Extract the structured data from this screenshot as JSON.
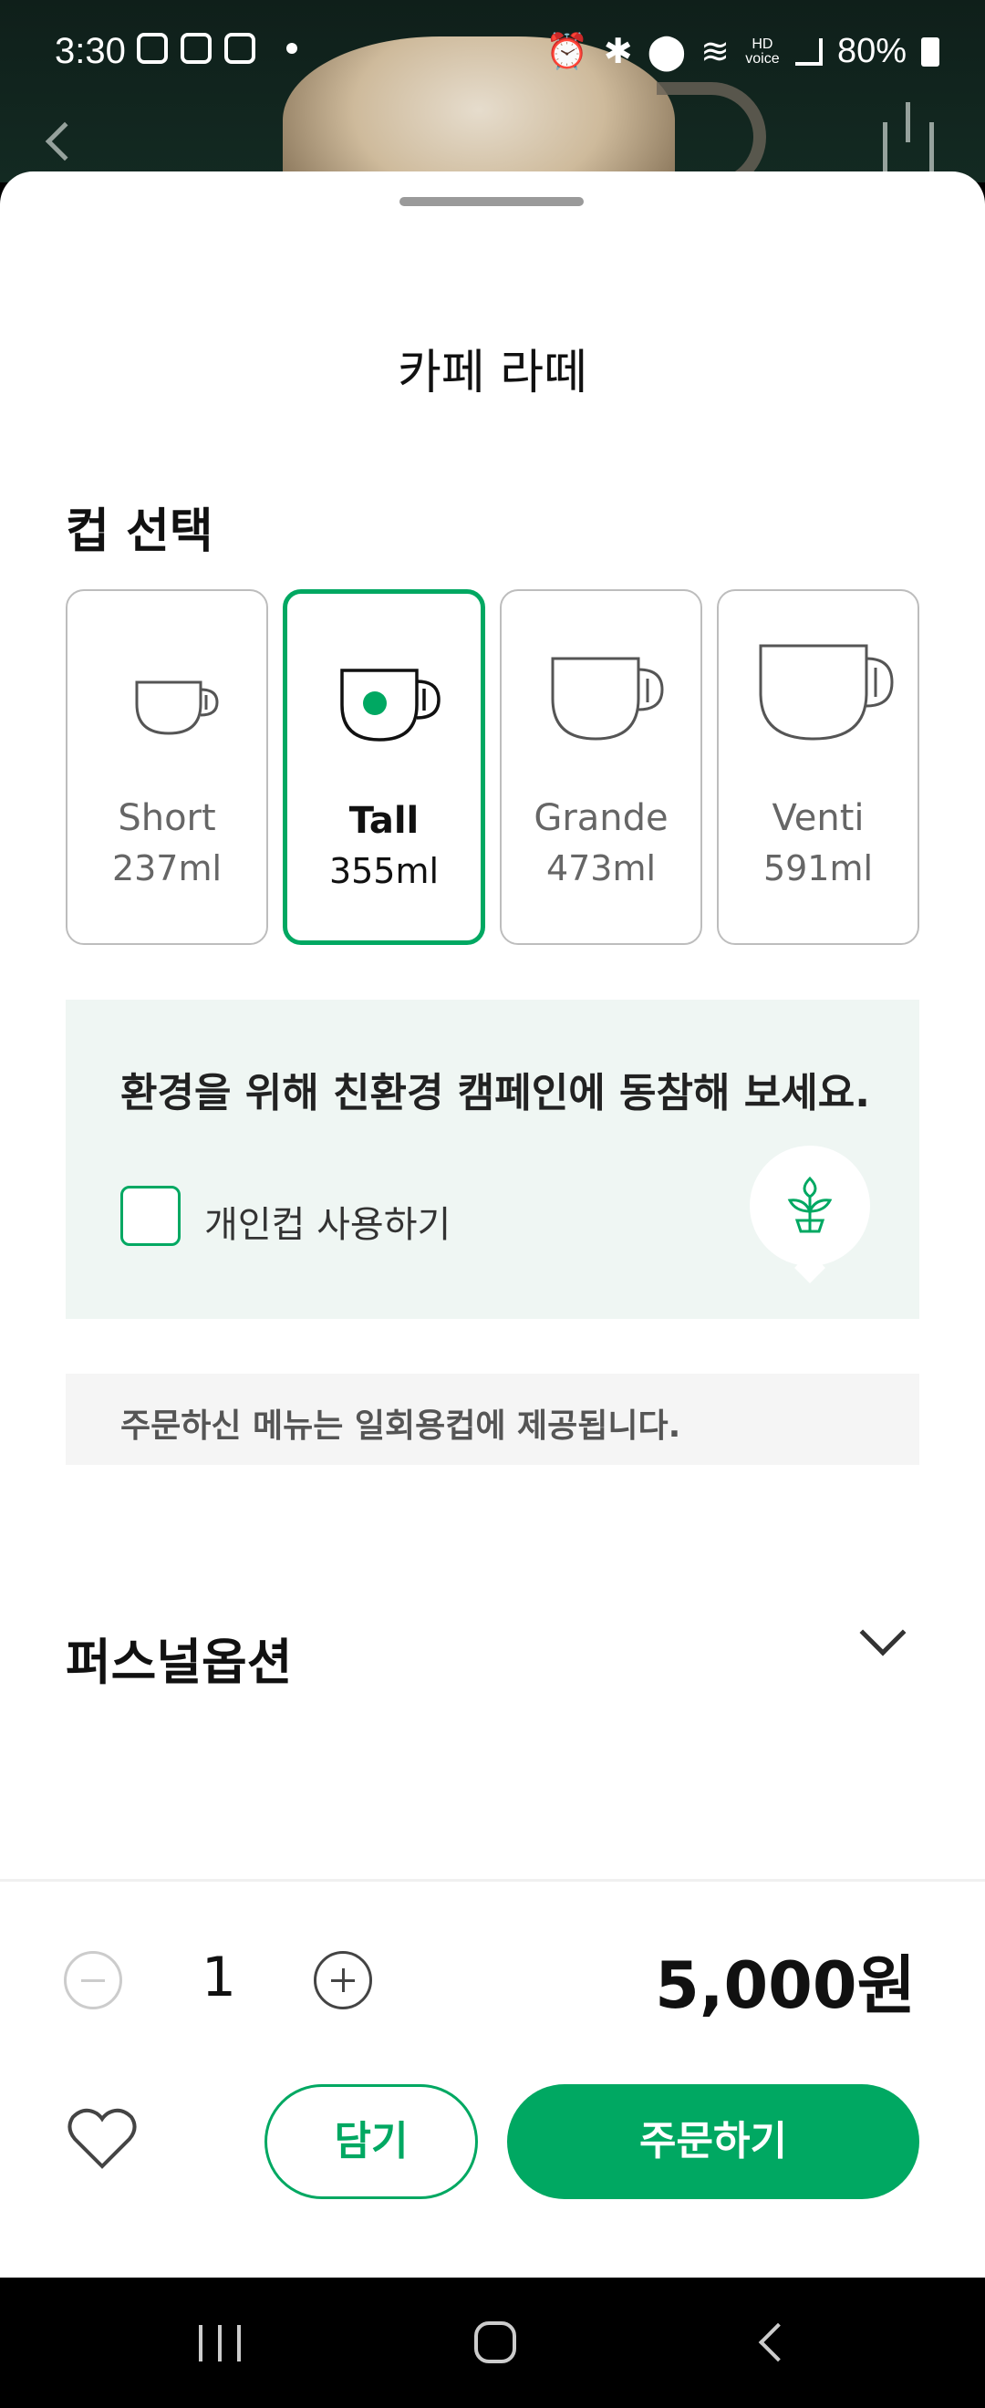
{
  "status_bar": {
    "time": "3:30",
    "battery": "80%",
    "network_badge": "HD voice"
  },
  "product": {
    "title": "카페 라떼"
  },
  "cup_section": {
    "heading": "컵 선택",
    "selected": "Tall",
    "options": [
      {
        "name": "Short",
        "volume": "237ml"
      },
      {
        "name": "Tall",
        "volume": "355ml"
      },
      {
        "name": "Grande",
        "volume": "473ml"
      },
      {
        "name": "Venti",
        "volume": "591ml"
      }
    ]
  },
  "eco": {
    "heading": "환경을 위해 친환경 캠페인에 동참해 보세요.",
    "checkbox_label": "개인컵 사용하기",
    "checked": false,
    "icon": "plant-icon"
  },
  "notice": {
    "text": "주문하신 메뉴는 일회용컵에 제공됩니다."
  },
  "personal_option": {
    "label": "퍼스널옵션"
  },
  "order": {
    "quantity": "1",
    "price": "5,000원",
    "cart_label": "담기",
    "order_label": "주문하기"
  },
  "colors": {
    "accent": "#00a862",
    "eco_bg": "#eff6f3"
  }
}
